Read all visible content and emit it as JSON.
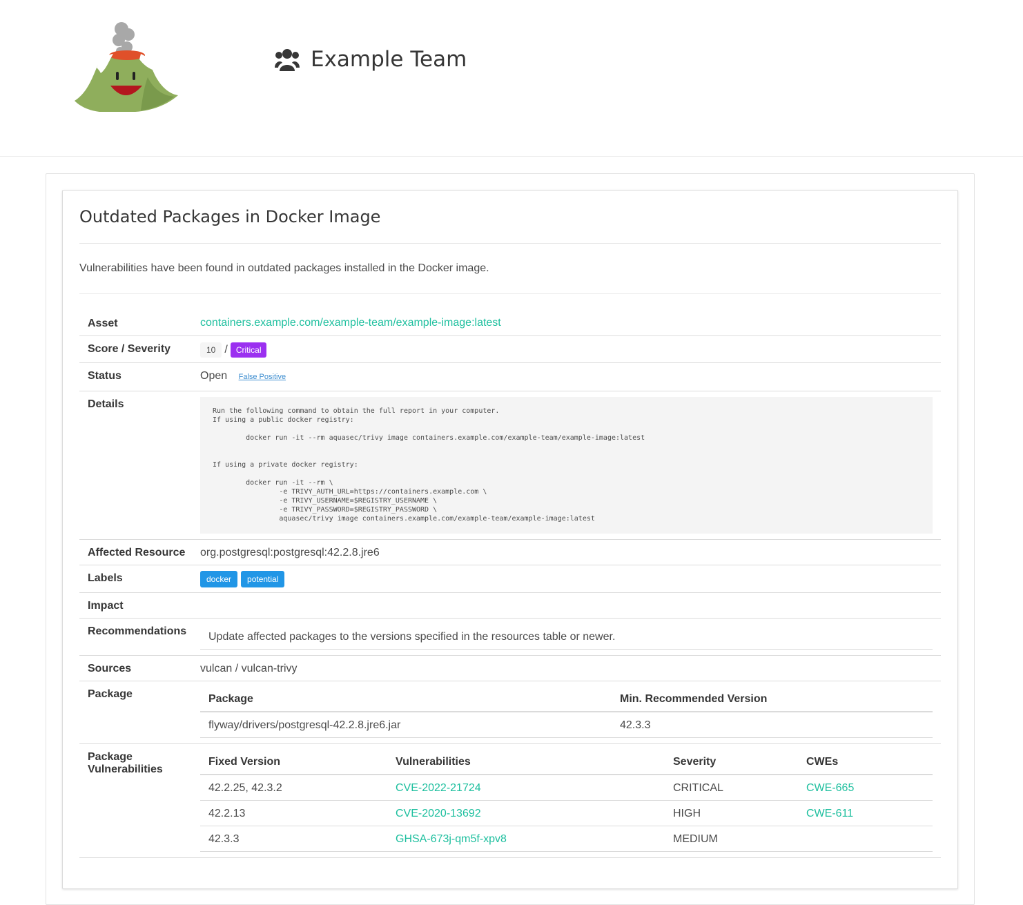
{
  "header": {
    "team_name": "Example Team"
  },
  "finding": {
    "title": "Outdated Packages in Docker Image",
    "description": "Vulnerabilities have been found in outdated packages installed in the Docker image.",
    "asset": {
      "label": "Asset",
      "value": "containers.example.com/example-team/example-image:latest"
    },
    "score": {
      "label": "Score / Severity",
      "value": "10",
      "separator": "/",
      "severity": "Critical",
      "severity_color": "#9b30f0"
    },
    "status": {
      "label": "Status",
      "value": "Open",
      "action": "False Positive"
    },
    "details": {
      "label": "Details",
      "text": "Run the following command to obtain the full report in your computer.\nIf using a public docker registry:\n\n        docker run -it --rm aquasec/trivy image containers.example.com/example-team/example-image:latest\n\n\nIf using a private docker registry:\n\n        docker run -it --rm \\\n                -e TRIVY_AUTH_URL=https://containers.example.com \\\n                -e TRIVY_USERNAME=$REGISTRY_USERNAME \\\n                -e TRIVY_PASSWORD=$REGISTRY_PASSWORD \\\n                aquasec/trivy image containers.example.com/example-team/example-image:latest"
    },
    "affected_resource": {
      "label": "Affected Resource",
      "value": "org.postgresql:postgresql:42.2.8.jre6"
    },
    "labels": {
      "label": "Labels",
      "items": [
        "docker",
        "potential"
      ]
    },
    "impact": {
      "label": "Impact",
      "value": ""
    },
    "recommendations": {
      "label": "Recommendations",
      "items": [
        "Update affected packages to the versions specified in the resources table or newer."
      ]
    },
    "sources": {
      "label": "Sources",
      "value": "vulcan / vulcan-trivy"
    },
    "package": {
      "label": "Package",
      "columns": [
        "Package",
        "Min. Recommended Version"
      ],
      "rows": [
        [
          "flyway/drivers/postgresql-42.2.8.jre6.jar",
          "42.3.3"
        ]
      ]
    },
    "package_vulnerabilities": {
      "label": "Package Vulnerabilities",
      "columns": [
        "Fixed Version",
        "Vulnerabilities",
        "Severity",
        "CWEs"
      ],
      "rows": [
        [
          "42.2.25, 42.3.2",
          "CVE-2022-21724",
          "CRITICAL",
          "CWE-665"
        ],
        [
          "42.2.13",
          "CVE-2020-13692",
          "HIGH",
          "CWE-611"
        ],
        [
          "42.3.3",
          "GHSA-673j-qm5f-xpv8",
          "MEDIUM",
          ""
        ]
      ]
    }
  },
  "colors": {
    "link": "#1dbf9e",
    "label_tag": "#2196e6",
    "critical": "#9b30f0"
  },
  "icons": {
    "logo": "volcano-mascot-logo",
    "team": "users-icon"
  }
}
